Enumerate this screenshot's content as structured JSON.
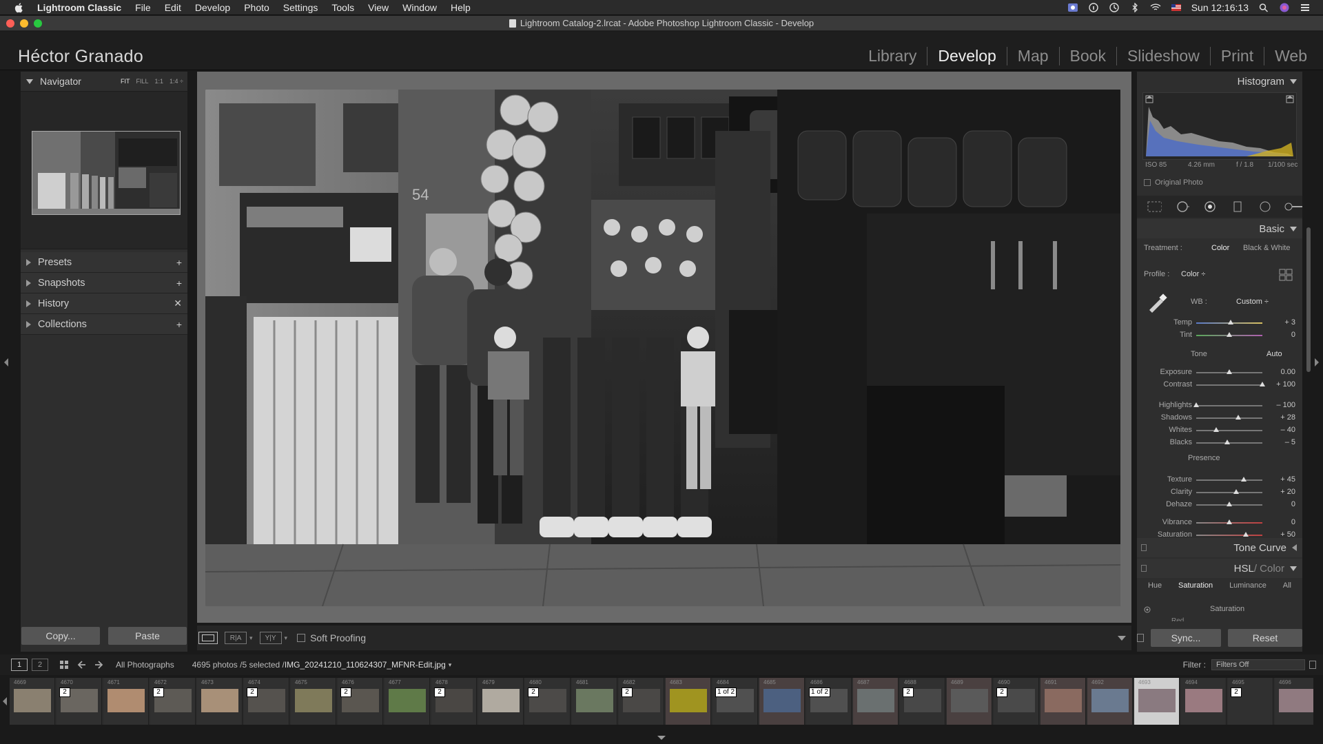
{
  "menubar": {
    "app": "Lightroom Classic",
    "items": [
      "File",
      "Edit",
      "Develop",
      "Photo",
      "Settings",
      "Tools",
      "View",
      "Window",
      "Help"
    ],
    "clock": "Sun 12:16:13"
  },
  "window": {
    "title": "Lightroom Catalog-2.lrcat - Adobe Photoshop Lightroom Classic - Develop"
  },
  "identity": "Héctor Granado",
  "modules": [
    "Library",
    "Develop",
    "Map",
    "Book",
    "Slideshow",
    "Print",
    "Web"
  ],
  "left": {
    "navigator": {
      "title": "Navigator",
      "options": [
        "FIT",
        "FILL",
        "1:1",
        "1:4 ÷"
      ]
    },
    "panels": [
      {
        "label": "Presets",
        "action": "+"
      },
      {
        "label": "Snapshots",
        "action": "+"
      },
      {
        "label": "History",
        "action": "✕"
      },
      {
        "label": "Collections",
        "action": "+"
      }
    ],
    "copy": "Copy...",
    "paste": "Paste"
  },
  "toolbar": {
    "soft_proofing": "Soft Proofing"
  },
  "right": {
    "histogram": {
      "title": "Histogram",
      "iso": "ISO 85",
      "focal": "4.26 mm",
      "aperture": "f / 1.8",
      "shutter": "1/100 sec",
      "original": "Original Photo"
    },
    "basic": {
      "title": "Basic",
      "treatment_label": "Treatment :",
      "treatment_color": "Color",
      "treatment_bw": "Black & White",
      "profile_label": "Profile :",
      "profile_value": "Color ÷",
      "wb_label": "WB :",
      "wb_value": "Custom ÷",
      "tone_label": "Tone",
      "auto": "Auto",
      "presence_label": "Presence",
      "sliders": [
        {
          "name": "Temp",
          "value": "+ 3",
          "pos": 0.52
        },
        {
          "name": "Tint",
          "value": "0",
          "pos": 0.5
        },
        {
          "name": "Exposure",
          "value": "0.00",
          "pos": 0.5
        },
        {
          "name": "Contrast",
          "value": "+ 100",
          "pos": 1.0
        },
        {
          "name": "Highlights",
          "value": "– 100",
          "pos": 0.0
        },
        {
          "name": "Shadows",
          "value": "+ 28",
          "pos": 0.64
        },
        {
          "name": "Whites",
          "value": "– 40",
          "pos": 0.3
        },
        {
          "name": "Blacks",
          "value": "– 5",
          "pos": 0.47
        },
        {
          "name": "Texture",
          "value": "+ 45",
          "pos": 0.72
        },
        {
          "name": "Clarity",
          "value": "+ 20",
          "pos": 0.6
        },
        {
          "name": "Dehaze",
          "value": "0",
          "pos": 0.5
        },
        {
          "name": "Vibrance",
          "value": "0",
          "pos": 0.5
        },
        {
          "name": "Saturation",
          "value": "+ 50",
          "pos": 0.75
        }
      ]
    },
    "tone_curve": "Tone Curve",
    "hsl": {
      "title_a": "HSL",
      "title_b": "/ Color",
      "tabs": [
        "Hue",
        "Saturation",
        "Luminance",
        "All"
      ],
      "sub": "Saturation",
      "cut": "Red"
    },
    "sync": "Sync...",
    "reset": "Reset"
  },
  "filmbar": {
    "views": [
      "1",
      "2"
    ],
    "source": "All Photographs",
    "count": "4695 photos /5 selected /",
    "file": "IMG_20241210_110624307_MFNR-Edit.jpg",
    "filter_label": "Filter :",
    "filter_value": "Filters Off"
  },
  "filmstrip": [
    {
      "num": "4669",
      "stack": "",
      "tone": "#8a8070"
    },
    {
      "num": "4670",
      "stack": "2",
      "tone": "#6a6660"
    },
    {
      "num": "4671",
      "stack": "",
      "tone": "#b08c70"
    },
    {
      "num": "4672",
      "stack": "2",
      "tone": "#5d5a55"
    },
    {
      "num": "4673",
      "stack": "",
      "tone": "#a89078"
    },
    {
      "num": "4674",
      "stack": "2",
      "tone": "#55524e"
    },
    {
      "num": "4675",
      "stack": "",
      "tone": "#7f7a5a"
    },
    {
      "num": "4676",
      "stack": "2",
      "tone": "#5a5650"
    },
    {
      "num": "4677",
      "stack": "",
      "tone": "#5f7a48"
    },
    {
      "num": "4678",
      "stack": "2",
      "tone": "#4a4744"
    },
    {
      "num": "4679",
      "stack": "",
      "tone": "#b0aaa0"
    },
    {
      "num": "4680",
      "stack": "2",
      "tone": "#4c4a48"
    },
    {
      "num": "4681",
      "stack": "",
      "tone": "#6a7860"
    },
    {
      "num": "4682",
      "stack": "2",
      "tone": "#4a4846"
    },
    {
      "num": "4683",
      "stack": "",
      "tone": "#a09420"
    },
    {
      "num": "4684",
      "stack": "1 of 2",
      "tone": "#505050"
    },
    {
      "num": "4685",
      "stack": "",
      "tone": "#4c6080"
    },
    {
      "num": "4686",
      "stack": "1 of 2",
      "tone": "#505050"
    },
    {
      "num": "4687",
      "stack": "",
      "tone": "#6a7070"
    },
    {
      "num": "4688",
      "stack": "2",
      "tone": "#484848"
    },
    {
      "num": "4689",
      "stack": "",
      "tone": "#5a5a5a"
    },
    {
      "num": "4690",
      "stack": "2",
      "tone": "#4a4a4a"
    },
    {
      "num": "4691",
      "stack": "",
      "tone": "#8a6a60"
    },
    {
      "num": "4692",
      "stack": "",
      "tone": "#6a7a90"
    },
    {
      "num": "4693",
      "stack": "",
      "tone": "#8a7a80"
    },
    {
      "num": "4694",
      "stack": "",
      "tone": "#9a7a80"
    },
    {
      "num": "4695",
      "stack": "2",
      "tone": "#303030"
    },
    {
      "num": "4696",
      "stack": "",
      "tone": "#907a80"
    }
  ]
}
